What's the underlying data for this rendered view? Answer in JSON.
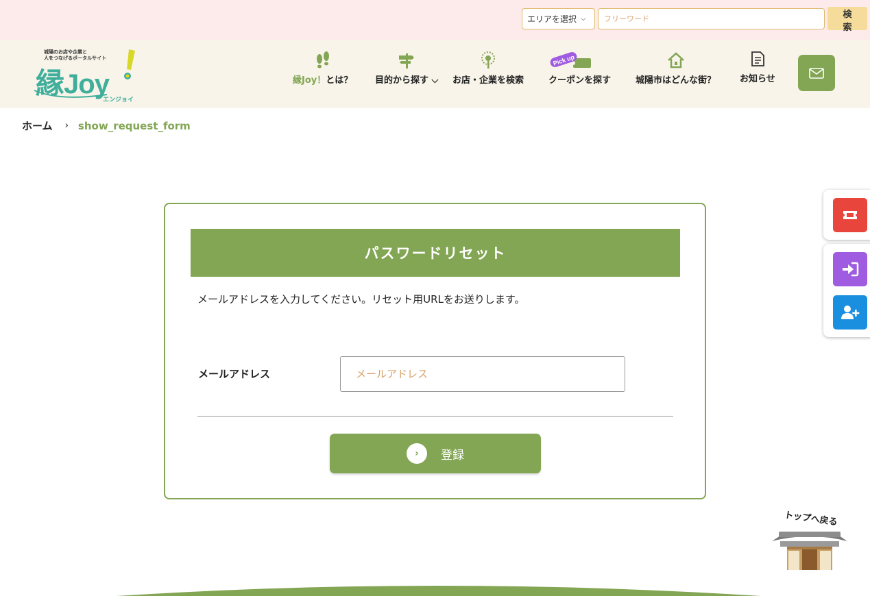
{
  "topbar": {
    "area_select_label": "エリアを選択",
    "free_word_placeholder": "フリーワード",
    "search_button": "検 索"
  },
  "logo": {
    "tagline_line1": "城陽のお店や企業と",
    "tagline_line2": "人をつなげるポータルサイト",
    "main_kanji": "縁",
    "main_latin": "Joy",
    "reading": "エンジョイ"
  },
  "nav": {
    "items": [
      {
        "label_prefix": "縁Joy！",
        "label": "とは？",
        "icon": "footprints-icon"
      },
      {
        "label": "目的から探す",
        "icon": "signpost-icon",
        "has_dropdown": true
      },
      {
        "label": "お店・企業を検索",
        "icon": "tree-icon"
      },
      {
        "label": "クーポンを探す",
        "icon": "ticket-icon",
        "badge": "Pick up"
      },
      {
        "label": "城陽市はどんな街？",
        "icon": "house-icon"
      },
      {
        "label": "お知らせ",
        "icon": "document-icon"
      }
    ],
    "mail_icon": "mail-icon"
  },
  "breadcrumb": {
    "home": "ホーム",
    "separator": "›",
    "current": "show_request_form"
  },
  "form": {
    "title": "パスワードリセット",
    "description": "メールアドレスを入力してください。リセット用URLをお送りします。",
    "email_label": "メールアドレス",
    "email_placeholder": "メールアドレス",
    "email_value": "",
    "submit_label": "登録"
  },
  "side": {
    "coupon_icon": "ticket-icon",
    "login_icon": "login-icon",
    "register_icon": "add-user-icon"
  },
  "back_to_top": {
    "label": "トップへ戻る"
  },
  "colors": {
    "brand_green": "#83a654",
    "topbar_pink": "#fdeaea",
    "header_beige": "#f8f4ea",
    "coupon_red": "#e8453c",
    "login_purple": "#a05ce0",
    "register_blue": "#1a8fe0"
  }
}
